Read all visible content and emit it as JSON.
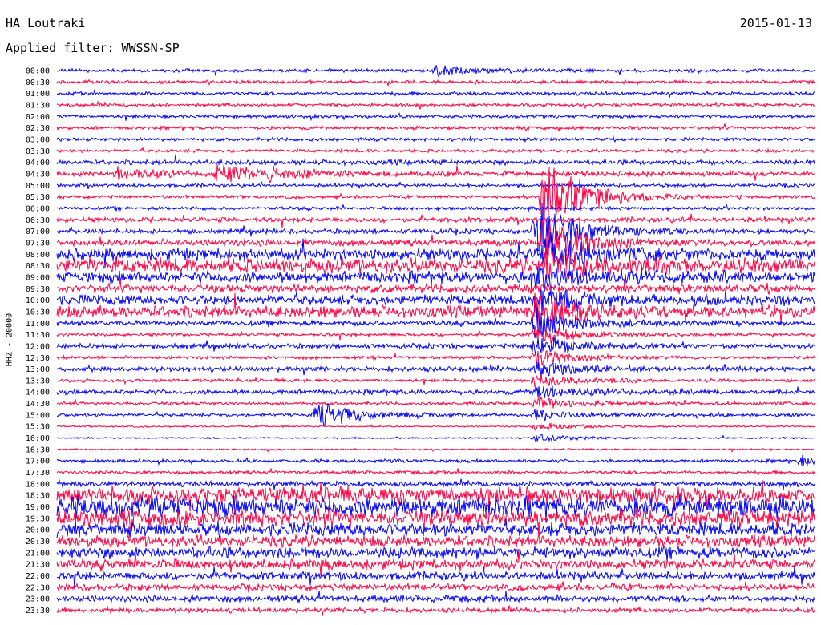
{
  "header": {
    "station": "HA Loutraki",
    "date": "2015-01-13",
    "filter": "Applied filter: WWSSN-SP"
  },
  "chart_data": {
    "type": "line",
    "title": "HA Loutraki",
    "channel_label": "HHZ - 20000",
    "date": "2015-01-13",
    "filter": "WWSSN-SP",
    "rows": [
      "00:00",
      "00:30",
      "01:00",
      "01:30",
      "02:00",
      "02:30",
      "03:00",
      "03:30",
      "04:00",
      "04:30",
      "05:00",
      "05:30",
      "06:00",
      "06:30",
      "07:00",
      "07:30",
      "08:00",
      "08:30",
      "09:00",
      "09:30",
      "10:00",
      "10:30",
      "11:00",
      "11:30",
      "12:00",
      "12:30",
      "13:00",
      "13:30",
      "14:00",
      "14:30",
      "15:00",
      "15:30",
      "16:00",
      "16:30",
      "17:00",
      "17:30",
      "18:00",
      "18:30",
      "19:00",
      "19:30",
      "20:00",
      "20:30",
      "21:00",
      "21:30",
      "22:00",
      "22:30",
      "23:00",
      "23:30"
    ],
    "trace_colors": [
      "#0000ff",
      "#ff0040"
    ],
    "base_amplitude": [
      2,
      2,
      2,
      2,
      2,
      2,
      2,
      2,
      3,
      3,
      2,
      2,
      2,
      3,
      3,
      4,
      7,
      9,
      7,
      5,
      6,
      7,
      3,
      2,
      3,
      2,
      3,
      2,
      3,
      2,
      2,
      1,
      1,
      1,
      2,
      2,
      3,
      10,
      12,
      10,
      8,
      7,
      7,
      6,
      5,
      4,
      4,
      3
    ],
    "events": [
      {
        "row": 11,
        "x": 0.64,
        "amplitude": 60
      },
      {
        "row": 14,
        "x": 0.63,
        "amplitude": 45
      },
      {
        "row": 15,
        "x": 0.64,
        "amplitude": 40
      },
      {
        "row": 16,
        "x": 0.64,
        "amplitude": 30
      },
      {
        "row": 17,
        "x": 0.64,
        "amplitude": 25
      },
      {
        "row": 18,
        "x": 0.63,
        "amplitude": 18
      },
      {
        "row": 20,
        "x": 0.63,
        "amplitude": 20
      },
      {
        "row": 21,
        "x": 0.63,
        "amplitude": 28
      },
      {
        "row": 22,
        "x": 0.63,
        "amplitude": 22
      },
      {
        "row": 23,
        "x": 0.63,
        "amplitude": 15
      },
      {
        "row": 24,
        "x": 0.63,
        "amplitude": 14
      },
      {
        "row": 25,
        "x": 0.63,
        "amplitude": 14
      },
      {
        "row": 26,
        "x": 0.63,
        "amplitude": 12
      },
      {
        "row": 27,
        "x": 0.63,
        "amplitude": 10
      },
      {
        "row": 28,
        "x": 0.63,
        "amplitude": 9
      },
      {
        "row": 29,
        "x": 0.63,
        "amplitude": 8
      },
      {
        "row": 30,
        "x": 0.63,
        "amplitude": 8
      },
      {
        "row": 31,
        "x": 0.63,
        "amplitude": 6
      },
      {
        "row": 32,
        "x": 0.63,
        "amplitude": 5
      },
      {
        "row": 30,
        "x": 0.34,
        "amplitude": 22
      },
      {
        "row": 9,
        "x": 0.21,
        "amplitude": 14
      },
      {
        "row": 9,
        "x": 0.08,
        "amplitude": 8
      },
      {
        "row": 9,
        "x": 0.28,
        "amplitude": 8
      },
      {
        "row": 0,
        "x": 0.5,
        "amplitude": 8
      },
      {
        "row": 34,
        "x": 0.98,
        "amplitude": 9
      }
    ]
  }
}
